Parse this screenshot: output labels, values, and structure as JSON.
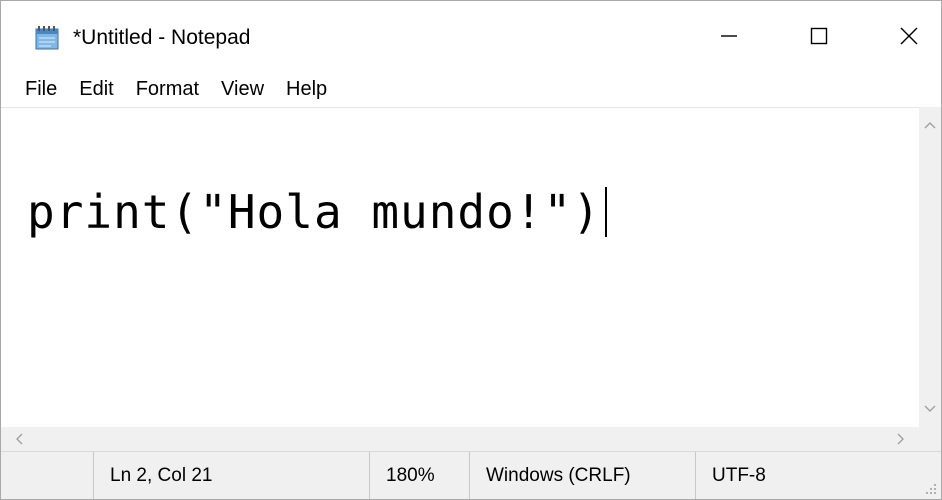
{
  "window": {
    "title": "*Untitled - Notepad",
    "icon": "notepad-icon",
    "controls": {
      "minimize": "minimize-icon",
      "maximize": "maximize-icon",
      "close": "close-icon"
    }
  },
  "menu": {
    "items": [
      "File",
      "Edit",
      "Format",
      "View",
      "Help"
    ]
  },
  "editor": {
    "text": "print(\"Hola mundo!\")"
  },
  "status": {
    "position": "Ln 2, Col 21",
    "zoom": "180%",
    "line_ending": "Windows (CRLF)",
    "encoding": "UTF-8"
  },
  "colors": {
    "chrome": "#f0f0f0",
    "text": "#000000",
    "background": "#ffffff"
  }
}
